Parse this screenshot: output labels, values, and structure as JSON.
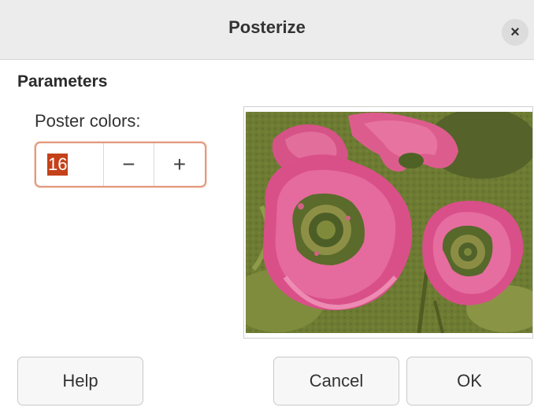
{
  "dialog": {
    "title": "Posterize",
    "close_icon": "×"
  },
  "parameters": {
    "section_title": "Parameters",
    "poster_colors_label": "Poster colors:",
    "poster_colors_value": "16",
    "decrement_symbol": "−",
    "increment_symbol": "+"
  },
  "preview": {
    "description_icon": "poppy-flowers-image"
  },
  "buttons": {
    "help": "Help",
    "cancel": "Cancel",
    "ok": "OK"
  },
  "colors": {
    "accent_focus": "#e29a7e",
    "selection": "#c4411a"
  }
}
